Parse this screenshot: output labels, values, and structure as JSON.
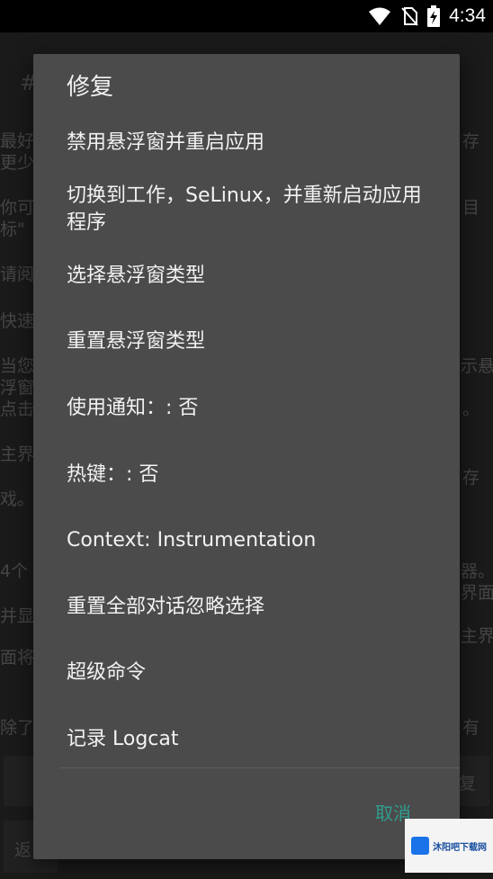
{
  "status_bar": {
    "time": "4:34"
  },
  "background": {
    "fragments": [
      "#",
      "最好",
      "更少",
      "你可",
      "标\"",
      "请阅",
      "快速",
      "当您",
      "浮窗",
      "点击",
      "主界",
      "戏。",
      "4个",
      "并显",
      "面将",
      "除了",
      "有",
      "存",
      "目",
      "示悬",
      "。",
      "存",
      "器。",
      "界面",
      "主界",
      "复",
      "返"
    ]
  },
  "dialog": {
    "title": "修复",
    "items": [
      "禁用悬浮窗并重启应用",
      "切换到工作，SeLinux，并重新启动应用程序",
      "选择悬浮窗类型",
      "重置悬浮窗类型",
      "使用通知：: 否",
      "热键：: 否",
      "Context: Instrumentation",
      "重置全部对话忽略选择",
      "超级命令",
      "记录 Logcat"
    ],
    "cancel": "取消"
  },
  "watermark": {
    "text": "沐阳吧下载网"
  }
}
